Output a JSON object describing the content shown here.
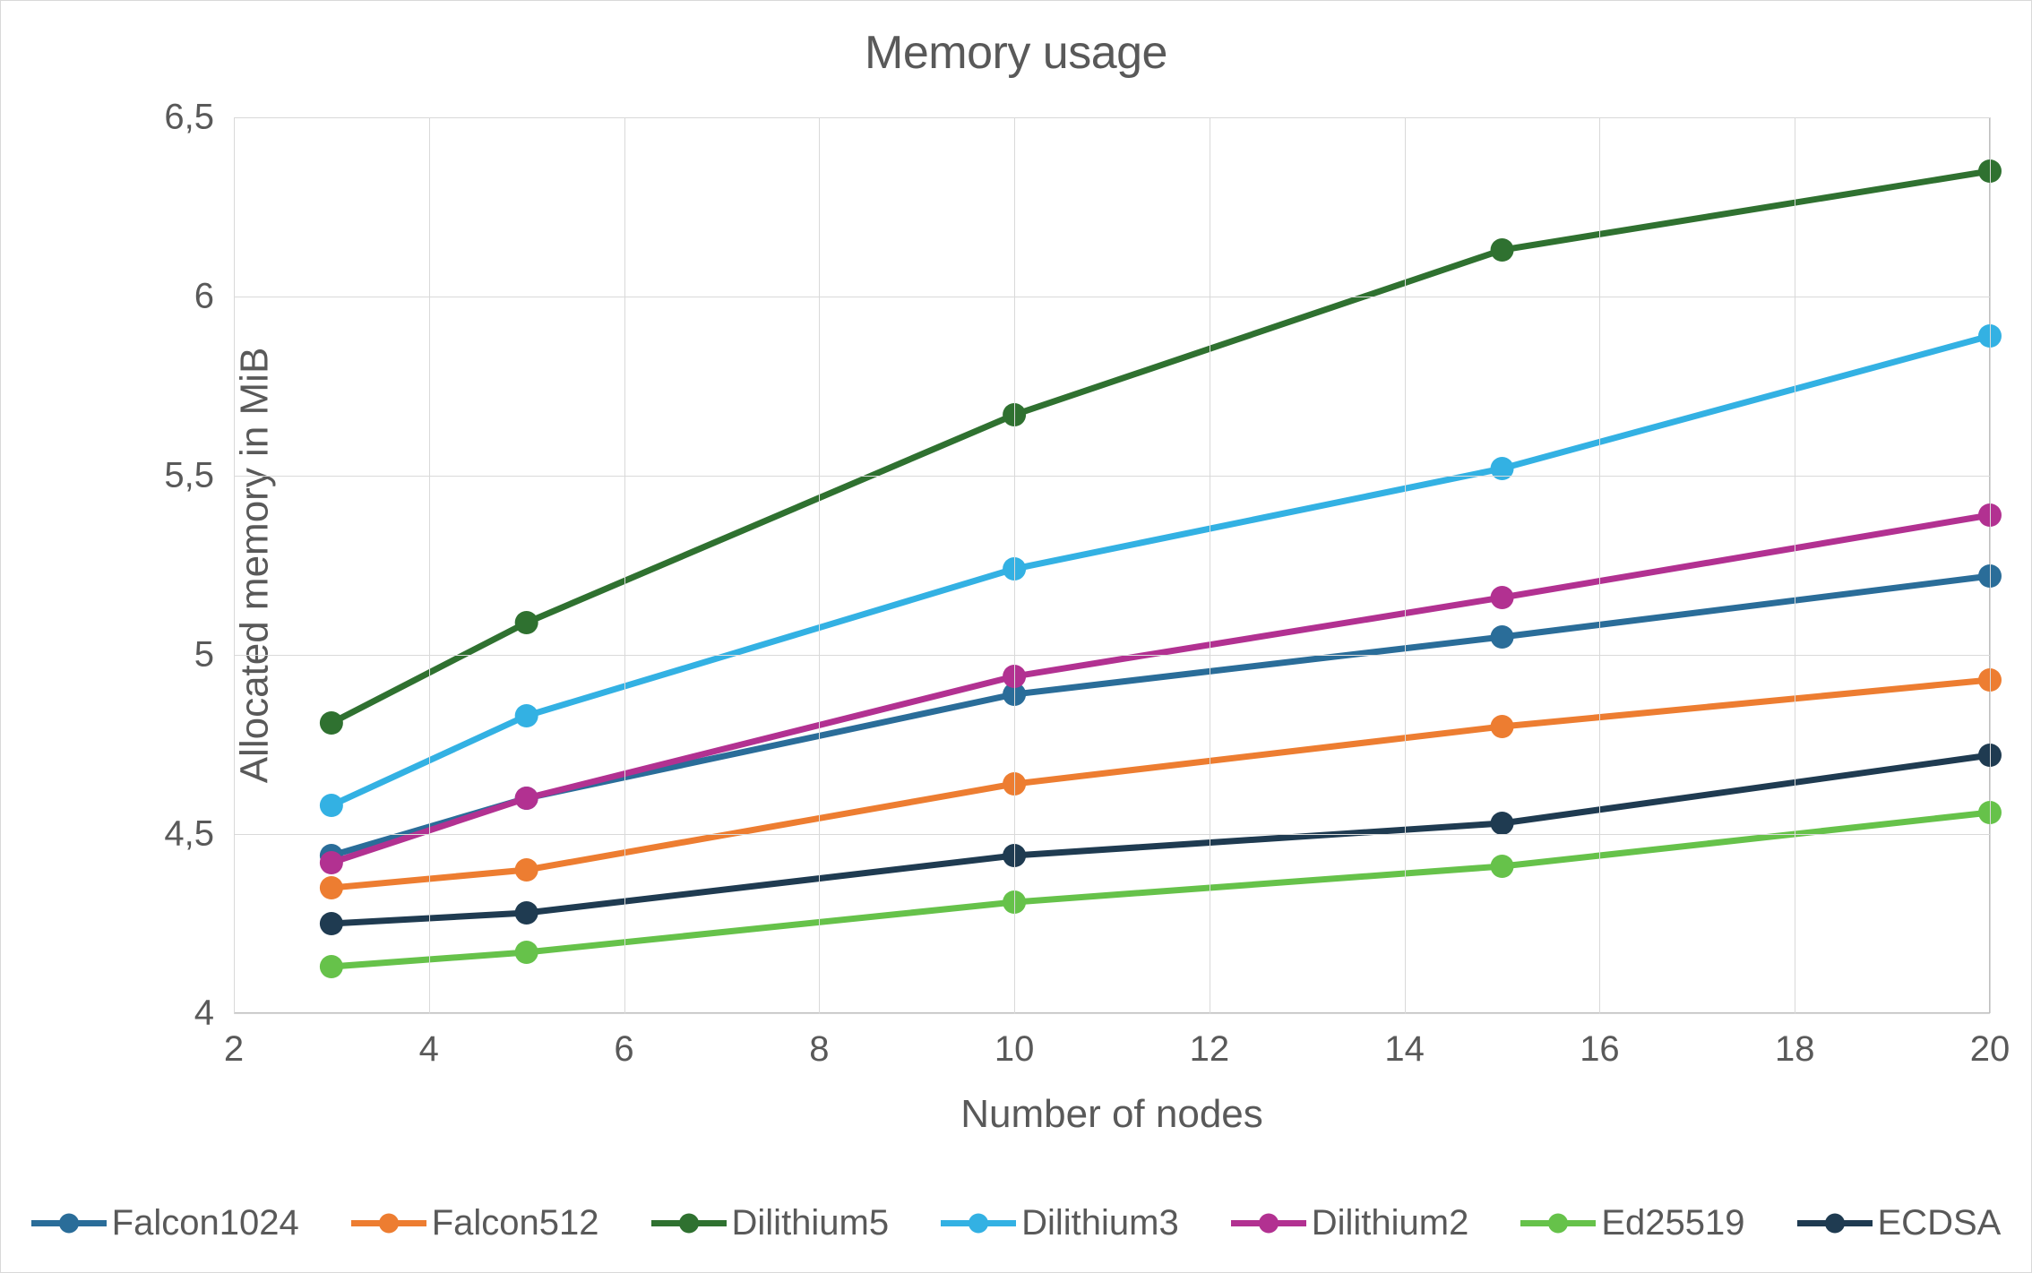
{
  "chart_data": {
    "type": "line",
    "title": "Memory usage",
    "xlabel": "Number of nodes",
    "ylabel": "Allocated memory in MiB",
    "xlim": [
      2,
      20
    ],
    "ylim": [
      4,
      6.5
    ],
    "x": [
      3,
      5,
      10,
      15,
      20
    ],
    "x_ticks": [
      2,
      4,
      6,
      8,
      10,
      12,
      14,
      16,
      18,
      20
    ],
    "y_ticks": [
      4,
      4.5,
      5,
      5.5,
      6,
      6.5
    ],
    "y_tick_labels": [
      "4",
      "4,5",
      "5",
      "5,5",
      "6",
      "6,5"
    ],
    "series": [
      {
        "name": "Falcon1024",
        "color": "#2a6d99",
        "values": [
          4.44,
          4.6,
          4.89,
          5.05,
          5.22
        ]
      },
      {
        "name": "Falcon512",
        "color": "#ed7d31",
        "values": [
          4.35,
          4.4,
          4.64,
          4.8,
          4.93
        ]
      },
      {
        "name": "Dilithium5",
        "color": "#2f7130",
        "values": [
          4.81,
          5.09,
          5.67,
          6.13,
          6.35
        ]
      },
      {
        "name": "Dilithium3",
        "color": "#33b1e3",
        "values": [
          4.58,
          4.83,
          5.24,
          5.52,
          5.89
        ]
      },
      {
        "name": "Dilithium2",
        "color": "#b23191",
        "values": [
          4.42,
          4.6,
          4.94,
          5.16,
          5.39
        ]
      },
      {
        "name": "Ed25519",
        "color": "#66c24a",
        "values": [
          4.13,
          4.17,
          4.31,
          4.41,
          4.56
        ]
      },
      {
        "name": "ECDSA",
        "color": "#1f3b51",
        "values": [
          4.25,
          4.28,
          4.44,
          4.53,
          4.72
        ]
      }
    ],
    "legend_position": "bottom",
    "grid": true
  }
}
